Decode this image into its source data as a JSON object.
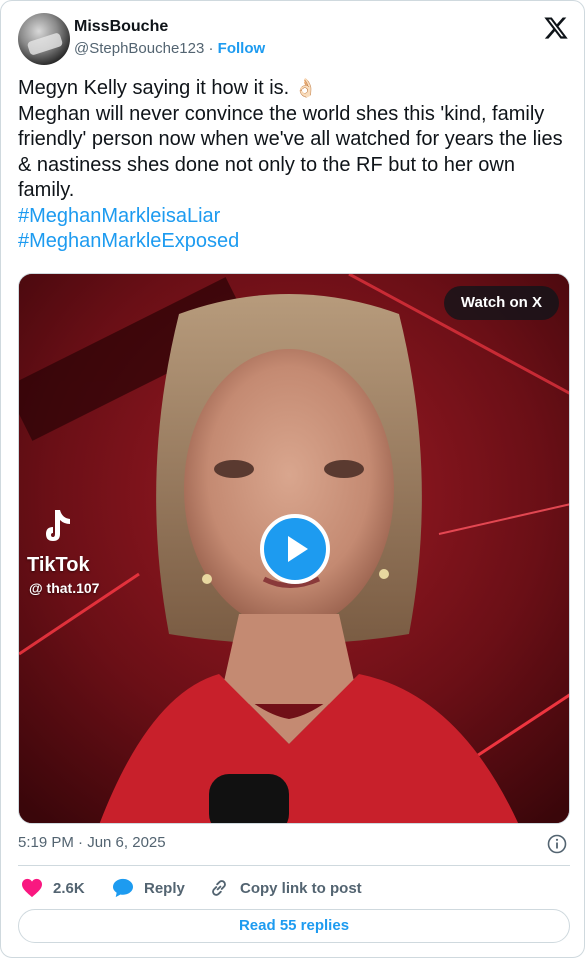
{
  "author": {
    "name": "MissBouche",
    "handle": "@StephBouche123",
    "separator": "·",
    "follow_label": "Follow"
  },
  "tweet": {
    "line1": "Megyn Kelly saying it how it is.",
    "emoji": "👌🏻",
    "body": "Meghan will never convince the world shes this 'kind, family friendly' person now when we've all watched for years the lies & nastiness shes done not only to the RF but to her own family.",
    "hashtags": [
      "#MeghanMarkleisaLiar",
      "#MeghanMarkleExposed"
    ]
  },
  "media": {
    "watch_label": "Watch on X",
    "tiktok_brand": "TikTok",
    "tiktok_user": "@ that.107"
  },
  "meta": {
    "timestamp": "5:19 PM · Jun 6, 2025"
  },
  "actions": {
    "likes": "2.6K",
    "reply_label": "Reply",
    "copy_label": "Copy link to post",
    "read_replies": "Read 55 replies"
  },
  "colors": {
    "accent": "#1d9bf0",
    "like": "#f91880",
    "muted": "#536471",
    "border": "#cfd9de"
  },
  "icons": {
    "x_logo": "x-logo-icon",
    "play": "play-icon",
    "info": "info-icon",
    "heart": "heart-icon",
    "reply": "speech-bubble-icon",
    "link": "link-icon",
    "tiktok": "tiktok-logo-icon"
  }
}
